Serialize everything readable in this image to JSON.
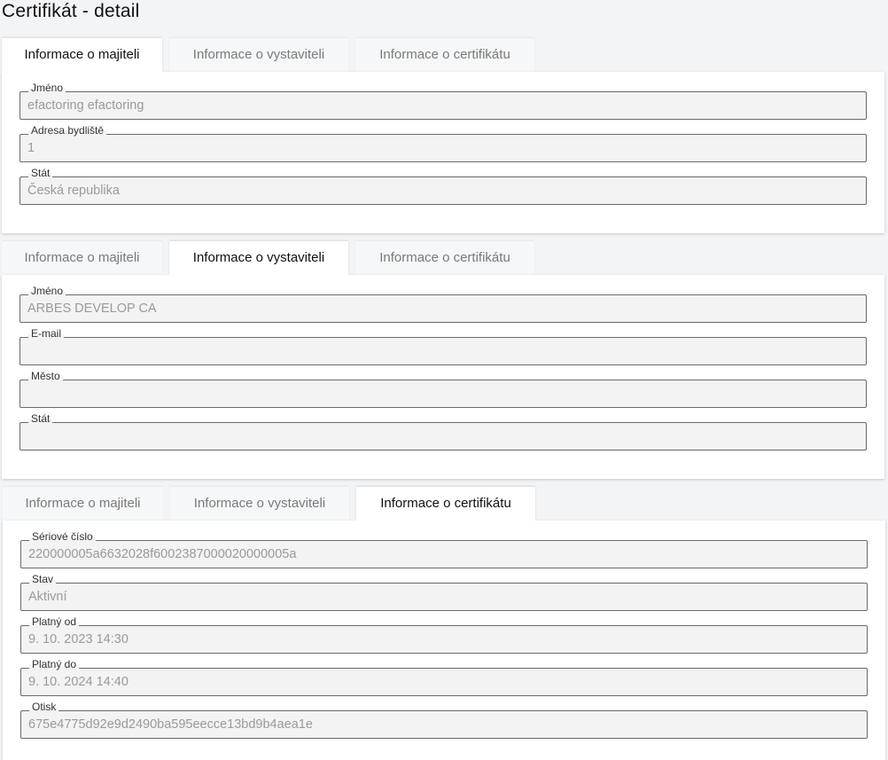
{
  "page": {
    "title": "Certifikát - detail"
  },
  "tabs": [
    "Informace o majiteli",
    "Informace o vystaviteli",
    "Informace o certifikátu"
  ],
  "owner": {
    "fields": [
      {
        "label": "Jméno",
        "value": "efactoring efactoring"
      },
      {
        "label": "Adresa bydliště",
        "value": "1"
      },
      {
        "label": "Stát",
        "value": "Česká republika"
      }
    ]
  },
  "issuer": {
    "fields": [
      {
        "label": "Jméno",
        "value": "ARBES DEVELOP CA"
      },
      {
        "label": "E-mail",
        "value": ""
      },
      {
        "label": "Město",
        "value": ""
      },
      {
        "label": "Stát",
        "value": ""
      }
    ]
  },
  "certificate": {
    "fields": [
      {
        "label": "Sériové číslo",
        "value": "220000005a6632028f6002387000020000005a"
      },
      {
        "label": "Stav",
        "value": "Aktivní"
      },
      {
        "label": "Platný od",
        "value": "9. 10. 2023 14:30"
      },
      {
        "label": "Platný do",
        "value": "9. 10. 2024 14:40"
      },
      {
        "label": "Otisk",
        "value": "675e4775d92e9d2490ba595eecce13bd9b4aea1e"
      }
    ]
  }
}
